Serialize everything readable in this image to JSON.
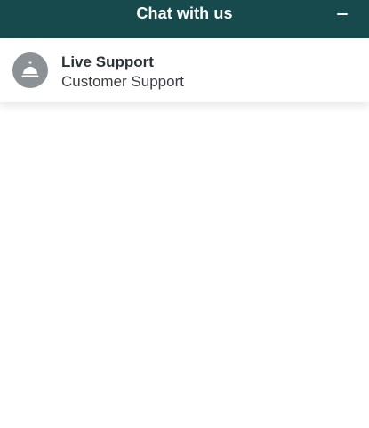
{
  "header": {
    "title": "Chat with us",
    "minimize_icon": "minus-icon",
    "background": "#174a4d"
  },
  "agent": {
    "name": "Live Support",
    "role": "Customer Support",
    "avatar_icon": "service-bell-icon",
    "avatar_color": "#8c9196"
  }
}
